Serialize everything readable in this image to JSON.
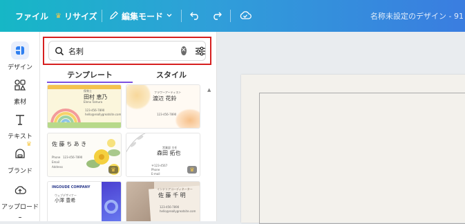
{
  "topbar": {
    "file_label": "ファイル",
    "resize_label": "リサイズ",
    "edit_mode_label": "編集モード",
    "title": "名称未設定のデザイン - 91",
    "icons": [
      "crown-icon",
      "pencil-icon",
      "chevron-down-icon",
      "undo-icon",
      "redo-icon",
      "cloud-check-icon"
    ]
  },
  "rail": {
    "items": [
      {
        "label": "デザイン",
        "icon": "design-icon",
        "active": true
      },
      {
        "label": "素材",
        "icon": "elements-icon"
      },
      {
        "label": "テキスト",
        "icon": "text-icon"
      },
      {
        "label": "ブランド",
        "icon": "brand-icon"
      },
      {
        "label": "アップロード",
        "icon": "upload-icon"
      }
    ]
  },
  "panel": {
    "search": {
      "value": "名刺",
      "icons": [
        "search-icon",
        "clear-icon",
        "filter-icon"
      ]
    },
    "tabs": [
      {
        "label": "テンプレート",
        "active": true
      },
      {
        "label": "スタイル",
        "active": false
      }
    ],
    "templates": [
      {
        "name": "田村 恵乃",
        "lines": [
          "保育士",
          "Eleno Tamura",
          "123-456-7890",
          "hello@reallygreatsite.com"
        ]
      },
      {
        "name": "渡辺 花鈴",
        "lines": [
          "フラワーアーティスト",
          "123-456-7890"
        ]
      },
      {
        "name": "佐 藤 ち あ き",
        "lines": [
          "Phone",
          "Email",
          "Address",
          "123-456-7890"
        ]
      },
      {
        "name": "森田 拓也",
        "lines": [
          "営業部 主任",
          "〒123-4567",
          "Phone",
          "E-mail"
        ]
      },
      {
        "name": "小澤 豊希",
        "company": "INGOUDE COMPANY",
        "lines": [
          "ウェブデザイナー"
        ]
      },
      {
        "name": "佐 藤 千 明",
        "lines": [
          "インテリアコーディネーター",
          "123-456-7890",
          "hello@reallygreatsite.com"
        ]
      }
    ]
  },
  "colors": {
    "accent": "#7b4fe0",
    "highlight_border": "#d61f1f",
    "topbar_start": "#16b7c6",
    "topbar_end": "#3a7de0",
    "crown": "#f7c948"
  }
}
